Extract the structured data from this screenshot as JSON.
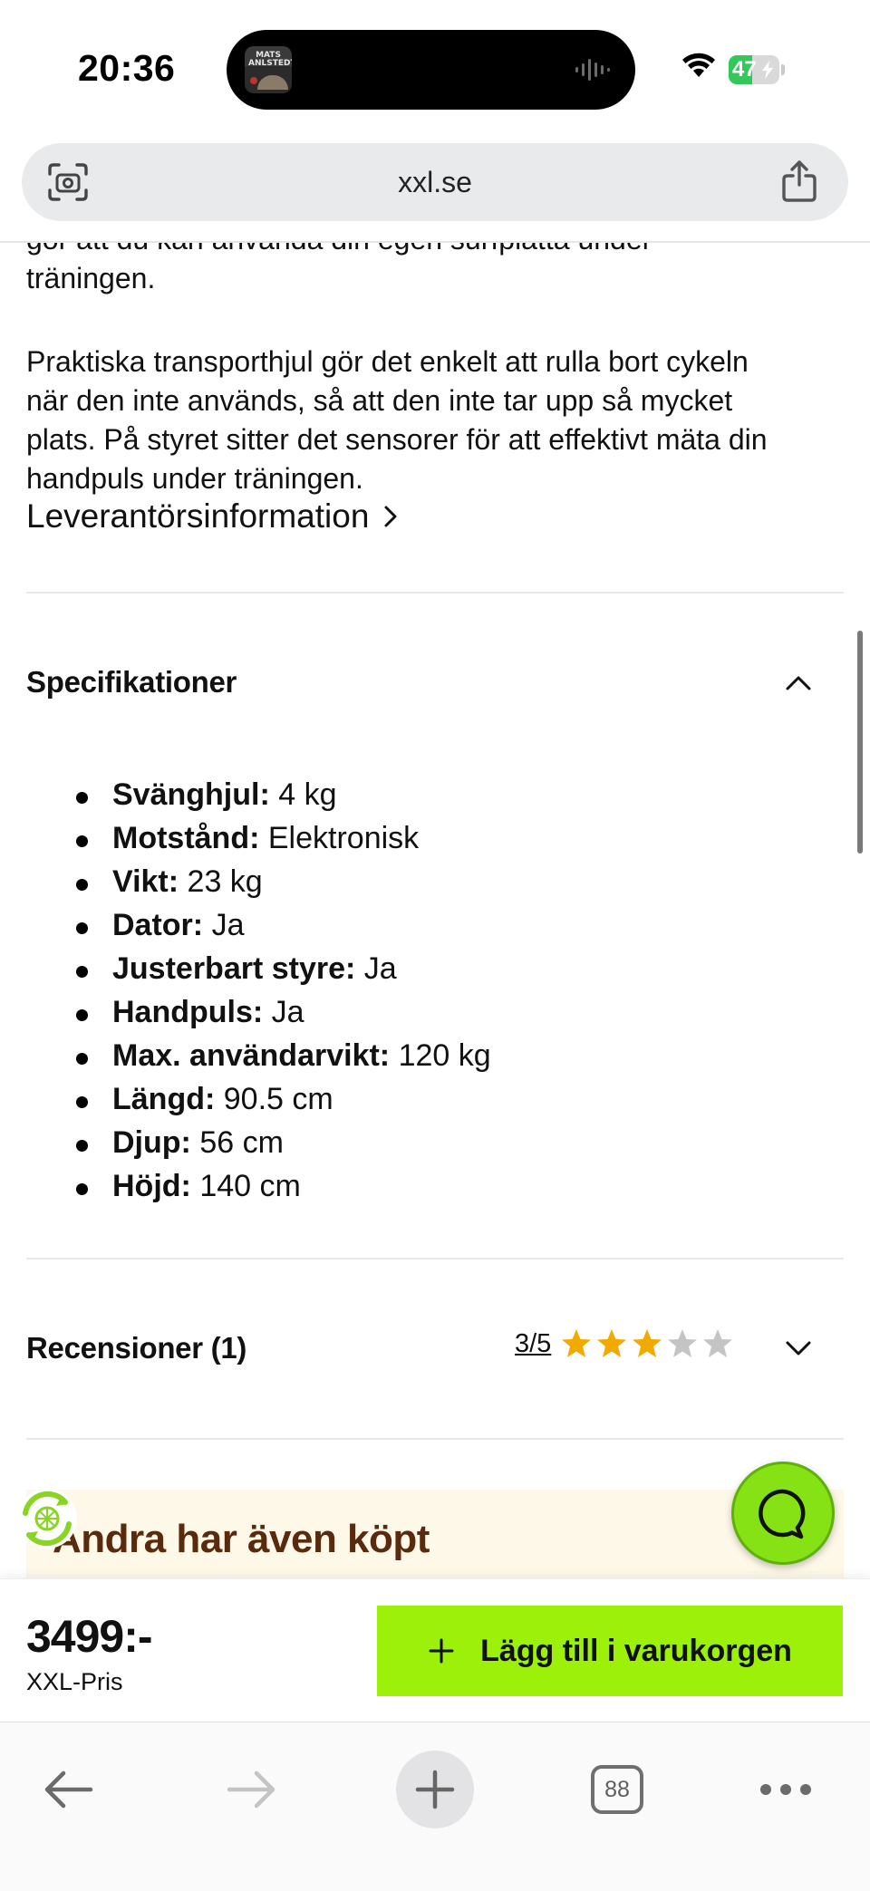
{
  "status_bar": {
    "time": "20:36",
    "now_playing_art_text": "MATS ANLSTEDT",
    "battery_level": "47",
    "icons": [
      "wifi-icon",
      "battery-charging-icon",
      "waveform-icon"
    ]
  },
  "browser": {
    "url": "xxl.se",
    "left_icon": "camera-scan-icon",
    "right_icon": "share-icon",
    "tabs_count": "88",
    "toolbar_icons": [
      "back-arrow-icon",
      "forward-arrow-icon",
      "plus-icon",
      "tabs-icon",
      "more-dots-icon"
    ]
  },
  "description": {
    "paragraph1_lines": [
      "gör att du kan använda din egen surfplatta under",
      "träningen."
    ],
    "paragraph2_lines": [
      "Praktiska transporthjul gör det enkelt att rulla bort cykeln",
      "när den inte används, så att den inte tar upp så mycket",
      "plats. På styret sitter det sensorer för att effektivt mäta din",
      "handpuls under träningen."
    ],
    "supplier_link": "Leverantörsinformation"
  },
  "specifications": {
    "title": "Specifikationer",
    "items": [
      {
        "key": "Svänghjul:",
        "value": "4 kg"
      },
      {
        "key": "Motstånd:",
        "value": "Elektronisk"
      },
      {
        "key": "Vikt:",
        "value": "23 kg"
      },
      {
        "key": "Dator:",
        "value": "Ja"
      },
      {
        "key": "Justerbart styre:",
        "value": "Ja"
      },
      {
        "key": "Handpuls:",
        "value": "Ja"
      },
      {
        "key": "Max. användarvikt:",
        "value": "120 kg"
      },
      {
        "key": "Längd:",
        "value": "90.5 cm"
      },
      {
        "key": "Djup:",
        "value": "56 cm"
      },
      {
        "key": "Höjd:",
        "value": "140 cm"
      }
    ]
  },
  "reviews": {
    "title": "Recensioner (1)",
    "score_text": "3/5",
    "rating": 3,
    "max_rating": 5,
    "star_color_filled": "#f2a900",
    "star_color_empty": "#c4c4c4"
  },
  "others_bought": {
    "title": "Andra har även köpt"
  },
  "buy_bar": {
    "price": "3499:-",
    "price_label": "XXL-Pris",
    "add_to_cart": "Lägg till i varukorgen",
    "button_color": "#9cf00a"
  },
  "colors": {
    "accent_green": "#9cf00a",
    "chat_green": "#86e214",
    "banner_bg": "#fdf8e8",
    "banner_title": "#5a2a0d"
  }
}
